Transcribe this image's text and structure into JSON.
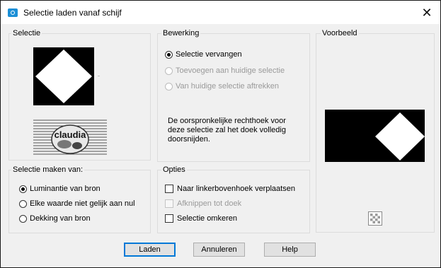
{
  "window": {
    "title": "Selectie laden vanaf schijf",
    "close_glyph": "✕"
  },
  "selectie": {
    "title": "Selectie",
    "watermark_text": "claudia"
  },
  "bewerking": {
    "title": "Bewerking",
    "options": [
      {
        "label": "Selectie vervangen",
        "checked": true,
        "enabled": true
      },
      {
        "label": "Toevoegen aan huidige selectie",
        "checked": false,
        "enabled": false
      },
      {
        "label": "Van huidige selectie aftrekken",
        "checked": false,
        "enabled": false
      }
    ],
    "description": [
      "De oorspronkelijke rechthoek voor",
      "deze selectie zal het doek volledig",
      "doorsnijden."
    ]
  },
  "voorbeeld": {
    "title": "Voorbeeld"
  },
  "bron": {
    "title": "Selectie maken van:",
    "options": [
      {
        "label": "Luminantie van bron",
        "checked": true
      },
      {
        "label": "Elke waarde niet gelijk aan nul",
        "checked": false
      },
      {
        "label": "Dekking van bron",
        "checked": false
      }
    ]
  },
  "opties": {
    "title": "Opties",
    "items": [
      {
        "label": "Naar linkerbovenhoek verplaatsen",
        "checked": false,
        "enabled": true
      },
      {
        "label": "Afknippen tot doek",
        "checked": false,
        "enabled": false
      },
      {
        "label": "Selectie omkeren",
        "checked": false,
        "enabled": true
      }
    ]
  },
  "buttons": {
    "load": "Laden",
    "cancel": "Annuleren",
    "help": "Help"
  },
  "colors": {
    "accent": "#0078d7",
    "title_icon": "#1b8fd6"
  }
}
